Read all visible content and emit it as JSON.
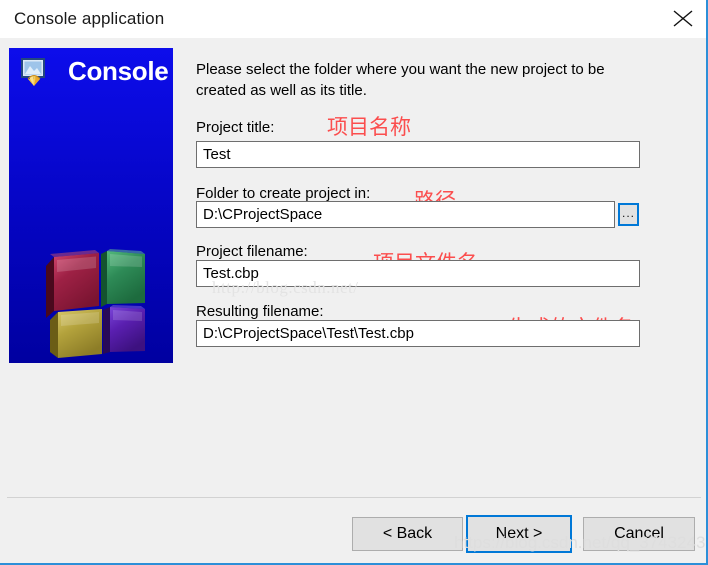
{
  "window": {
    "title": "Console application",
    "close_icon": "close-icon"
  },
  "sidebar": {
    "logo_text": "Console",
    "logo_icon": "wizard-image-icon",
    "illustration_icon": "codeblocks-four-cubes-logo"
  },
  "main": {
    "description": "Please select the folder where you want the new project to be created as well as its title.",
    "fields": [
      {
        "label": "Project title:",
        "value": "Test",
        "annotation": "项目名称"
      },
      {
        "label": "Folder to create project in:",
        "value": "D:\\CProjectSpace",
        "annotation": "路径",
        "browse_label": "..."
      },
      {
        "label": "Project filename:",
        "value": "Test.cbp",
        "annotation": "项目文件名"
      },
      {
        "label": "Resulting filename:",
        "value": "D:\\CProjectSpace\\Test\\Test.cbp",
        "annotation": "生成的文件名"
      }
    ]
  },
  "footer": {
    "back_label": "< Back",
    "next_label": "Next >",
    "cancel_label": "Cancel"
  },
  "watermarks": {
    "middle": "http://blog.csdn.net/",
    "bottom": "https://blog.csdn.net/qq_37432436"
  },
  "colors": {
    "accent": "#0078d7",
    "window_border": "#2c8fd8",
    "panel_blue_top": "#0d0deb",
    "panel_blue_bottom": "#0000a0",
    "dialog_background": "#f0f0f0",
    "annotation_red": "#fb4e4e",
    "cube_red": "#9e2145",
    "cube_green": "#2e8b57",
    "cube_yellow": "#b3a23c",
    "cube_purple": "#5a1fb0"
  }
}
